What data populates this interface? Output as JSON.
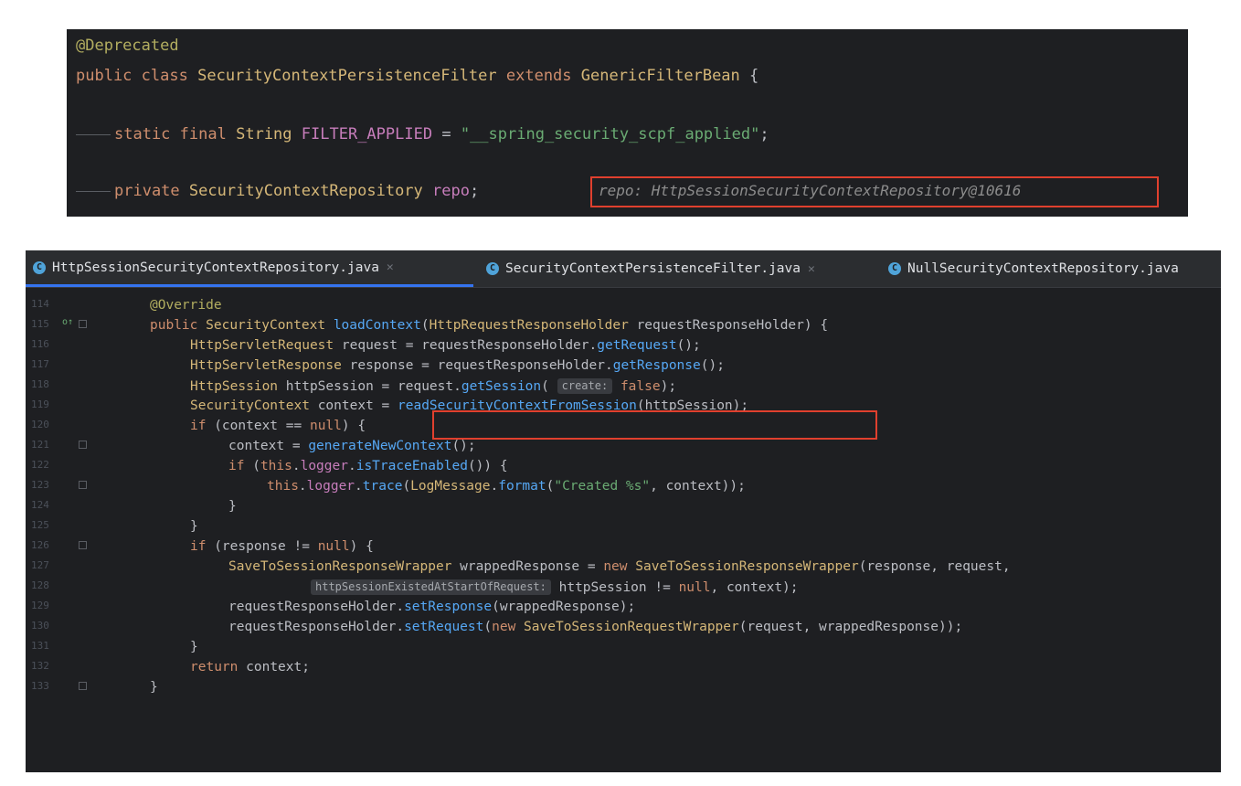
{
  "top_snippet": {
    "annotation": "@Deprecated",
    "class_line": {
      "kw1": "public",
      "kw2": "class",
      "name": "SecurityContextPersistenceFilter",
      "kw3": "extends",
      "parent": "GenericFilterBean",
      "brace": "{"
    },
    "field_line": {
      "kw1": "static",
      "kw2": "final",
      "type": "String",
      "name": "FILTER_APPLIED",
      "op": "=",
      "value": "\"__spring_security_scpf_applied\"",
      "end": ";"
    },
    "repo_line": {
      "kw": "private",
      "type": "SecurityContextRepository",
      "name": "repo",
      "end": ";",
      "debug_value": "repo: HttpSessionSecurityContextRepository@10616"
    }
  },
  "editor": {
    "tabs": [
      {
        "label": "HttpSessionSecurityContextRepository.java",
        "icon": "C",
        "active": true
      },
      {
        "label": "SecurityContextPersistenceFilter.java",
        "icon": "C",
        "active": false
      },
      {
        "label": "NullSecurityContextRepository.java",
        "icon": "C",
        "active": false
      }
    ],
    "line_numbers": [
      "114",
      "115",
      "116",
      "117",
      "118",
      "119",
      "120",
      "121",
      "122",
      "123",
      "124",
      "125",
      "126",
      "127",
      "128",
      "129",
      "130",
      "131",
      "132",
      "133"
    ],
    "gutter_mark": "o↑",
    "code": {
      "l114": "@Override",
      "l115": {
        "kw": "public",
        "type": "SecurityContext",
        "method": "loadContext",
        "open": "(",
        "ptype": "HttpRequestResponseHolder",
        "pname": "requestResponseHolder",
        "close": ") {"
      },
      "l116": {
        "type": "HttpServletRequest",
        "var": "request",
        "eq": " = ",
        "obj": "requestResponseHolder",
        "call": "getRequest",
        "end": "();"
      },
      "l117": {
        "type": "HttpServletResponse",
        "var": "response",
        "eq": " = ",
        "obj": "requestResponseHolder",
        "call": "getResponse",
        "end": "();"
      },
      "l118": {
        "type": "HttpSession",
        "var": "httpSession",
        "eq": " = ",
        "obj": "request",
        "call": "getSession",
        "hint": "create:",
        "val": "false",
        "end": ");"
      },
      "l119": {
        "type": "SecurityContext",
        "var": "context",
        "eq": " = ",
        "call": "readSecurityContextFromSession",
        "arg": "(httpSession);"
      },
      "l120": {
        "kw": "if",
        "cond": " (context == ",
        "nul": "null",
        "end": ") {"
      },
      "l121": {
        "var": "context",
        "eq": " = ",
        "call": "generateNewContext",
        "end": "();"
      },
      "l122": {
        "kw": "if",
        "open": " (",
        "this": "this",
        "dot": ".",
        "fld": "logger",
        "call": "isTraceEnabled",
        "end": "()) {"
      },
      "l123": {
        "this": "this",
        "fld": "logger",
        "call": "trace",
        "open": "(",
        "cls": "LogMessage",
        "fmt": "format",
        "str": "\"Created %s\"",
        "end": ", context));"
      },
      "l124": "}",
      "l125": "}",
      "l126": {
        "kw": "if",
        "cond": " (response != ",
        "nul": "null",
        "end": ") {"
      },
      "l127": {
        "type": "SaveToSessionResponseWrapper",
        "var": "wrappedResponse",
        "eq": " = ",
        "kw": "new",
        "cls": "SaveToSessionResponseWrapper",
        "end": "(response, request,"
      },
      "l128": {
        "hint": "httpSessionExistedAtStartOfRequest:",
        "expr": "httpSession != ",
        "nul": "null",
        "end": ", context);"
      },
      "l129": {
        "obj": "requestResponseHolder",
        "call": "setResponse",
        "end": "(wrappedResponse);"
      },
      "l130": {
        "obj": "requestResponseHolder",
        "call": "setRequest",
        "open": "(",
        "kw": "new",
        "cls": "SaveToSessionRequestWrapper",
        "end": "(request, wrappedResponse));"
      },
      "l131": "}",
      "l132": {
        "kw": "return",
        "end": "context;"
      },
      "l133": "}"
    }
  },
  "colors": {
    "background": "#1e1f22",
    "tab_bar": "#2b2d30",
    "highlight_box": "#e0402e",
    "keyword": "#cf8e6d",
    "method": "#56a8f5",
    "field": "#c77dbb",
    "string": "#6aab73"
  }
}
